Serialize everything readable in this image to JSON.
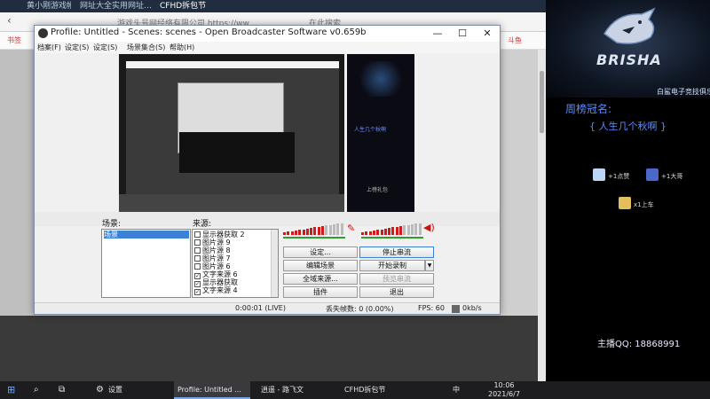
{
  "browser": {
    "tabs": [
      "黄小刚游戏帐…",
      "网址大全实用网址…",
      "CFHD拆包节"
    ],
    "address_text": "游戏头号网经络有限公司 https://ww…",
    "search_placeholder": "在此搜索",
    "nav_left": "书签",
    "nav_right": "斗鱼"
  },
  "obs": {
    "title": "Profile: Untitled - Scenes: scenes - Open Broadcaster Software v0.659b",
    "menu": [
      "档案(F)",
      "设定(S)",
      "设定(S)",
      "场景集合(S)",
      "帮助(H)"
    ],
    "scenes_label": "场景:",
    "sources_label": "来源:",
    "scene_items": [
      "场景"
    ],
    "sources": [
      {
        "label": "显示器获取 2",
        "checked": false
      },
      {
        "label": "图片源 9",
        "checked": false
      },
      {
        "label": "图片源 8",
        "checked": false
      },
      {
        "label": "图片源 7",
        "checked": false
      },
      {
        "label": "图片源 6",
        "checked": false
      },
      {
        "label": "文字来源 6",
        "checked": true
      },
      {
        "label": "显示器获取",
        "checked": true
      },
      {
        "label": "文字来源 4",
        "checked": true
      }
    ],
    "buttons": {
      "settings": "设定...",
      "stop_streaming": "停止串流",
      "edit_scene": "编辑场景",
      "start_recording": "开始录制",
      "global_sources": "全域来源...",
      "preview_stream": "预览串流",
      "plugins": "插件",
      "exit": "退出"
    },
    "status": {
      "time": "0:00:01 (LIVE)",
      "dropped_frames": "丢失帧数: 0 (0.00%)",
      "fps": "FPS: 60",
      "bitrate": "0kb/s"
    },
    "cam_overlay": [
      "人生几个秋啊",
      "上榜礼包"
    ]
  },
  "side": {
    "logo_text": "BRISHA",
    "logo_sub": "白鲨电子竞技俱乐部",
    "rank_title": "周榜冠名:",
    "rank_name": "{ 人生几个秋啊 }",
    "gifts": [
      "+1点赞",
      "+1大哥",
      "x1上车"
    ],
    "qq": "主播QQ: 18868991"
  },
  "taskbar": {
    "search": "设置",
    "items": [
      "Profile: Untitled ...",
      "逍遥 - 路飞文",
      "CFHD拆包节"
    ],
    "tray": "中",
    "time": "10:06",
    "date": "2021/6/7"
  },
  "colors": {
    "accent": "#3b82d6",
    "rank": "#5b8cff",
    "meter_red": "#d11a1a",
    "meter_green": "#2f9e2f"
  }
}
